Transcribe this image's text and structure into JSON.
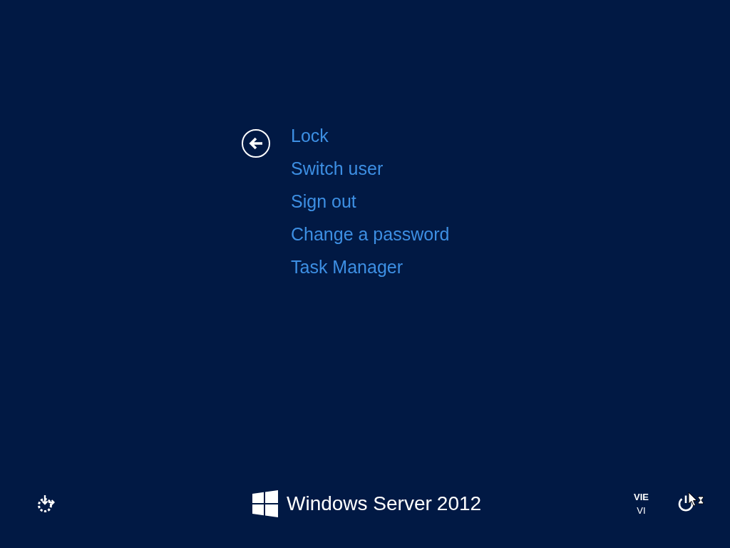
{
  "menu": {
    "items": [
      "Lock",
      "Switch user",
      "Sign out",
      "Change a password",
      "Task Manager"
    ]
  },
  "footer": {
    "logo": {
      "product": "Windows Server",
      "version": "2012"
    },
    "language": {
      "code": "VIE",
      "layout": "VI"
    }
  }
}
